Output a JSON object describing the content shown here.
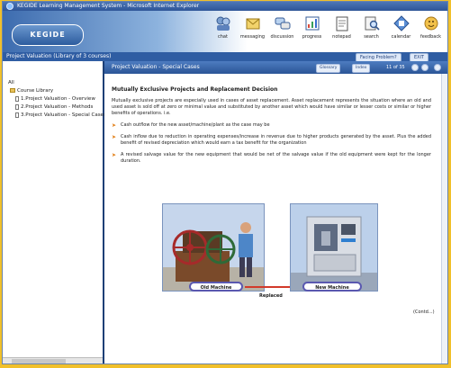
{
  "window": {
    "title": "KEGIDE Learning Management System - Microsoft Internet Explorer"
  },
  "header": {
    "logo_text": "KEGIDE",
    "nav": [
      {
        "label": "chat",
        "icon": "chat-icon"
      },
      {
        "label": "messaging",
        "icon": "messaging-icon"
      },
      {
        "label": "discussion",
        "icon": "discussion-icon"
      },
      {
        "label": "progress",
        "icon": "progress-icon"
      },
      {
        "label": "notepad",
        "icon": "notepad-icon"
      },
      {
        "label": "search",
        "icon": "search-icon"
      },
      {
        "label": "calendar",
        "icon": "calendar-icon"
      },
      {
        "label": "feedback",
        "icon": "feedback-icon"
      }
    ]
  },
  "statusbar": {
    "text": "Project Valuation (Library of 3 courses)",
    "facing_label": "Facing Problem?",
    "exit_label": "EXIT"
  },
  "sidebar": {
    "root_label": "All",
    "library_label": "Course Library",
    "items": [
      "1.Project Valuation - Overview",
      "2.Project Valuation - Methods",
      "3.Project Valuation - Special Cases"
    ]
  },
  "content": {
    "header_title": "Project Valuation - Special Cases",
    "btn_glossary": "Glossary",
    "btn_index": "Index",
    "page_count": "11 of 35",
    "heading": "Mutually Exclusive Projects and Replacement Decision",
    "intro": "Mutually exclusive projects are especially used in cases of asset replacement. Asset replacement represents the situation where an old and used asset is sold off at zero or minimal value and substituted by another asset which would have similar or lesser costs or similar or higher benefits of operations. i.e.",
    "bullets": [
      "Cash outflow for the new asset/machine/plant as the case may be",
      "Cash inflow due to reduction in operating expenses/increase in revenue due to higher products generated by the asset. Plus the added benefit of revised depreciation which would earn a tax benefit for the organization",
      "A revised salvage value for the new equipment that would be net of the salvage value if the old equipment were kept for the longer duration."
    ],
    "old_caption": "Old Machine",
    "new_caption": "New Machine",
    "replaced_label": "Replaced",
    "contd": "(Contd...)"
  },
  "colors": {
    "header_blue": "#2f5da3",
    "accent_orange": "#e07b10",
    "caption_border": "#5a58b0",
    "background": "#f1c02a"
  }
}
